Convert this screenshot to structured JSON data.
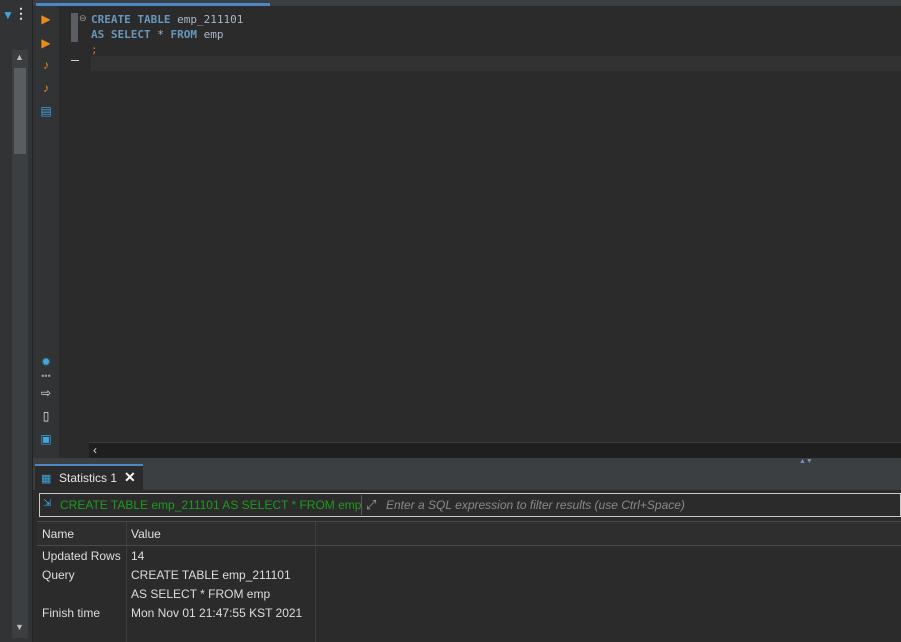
{
  "editor": {
    "line1": {
      "kw": "CREATE TABLE",
      "rest": " emp_211101"
    },
    "line2": {
      "kw1": "AS SELECT",
      "star": " * ",
      "kw2": "FROM",
      "rest": " emp"
    },
    "line3": ";"
  },
  "results": {
    "tab_label": "Statistics 1",
    "filter": {
      "query_text": "CREATE TABLE emp_211101 AS SELECT * FROM emp",
      "placeholder": "Enter a SQL expression to filter results (use Ctrl+Space)"
    },
    "columns": [
      "Name",
      "Value"
    ],
    "rows": [
      {
        "name": "Updated Rows",
        "value": "14"
      },
      {
        "name": "Query",
        "value": "CREATE TABLE emp_211101",
        "value2": "AS SELECT * FROM emp"
      },
      {
        "name": "Finish time",
        "value": "Mon Nov 01 21:47:55 KST 2021"
      }
    ]
  },
  "colors": {
    "accent": "#4a88c7",
    "keyword": "#6897bb",
    "filter_text": "#1f9a1f",
    "tool_orange": "#e98b1b",
    "tool_blue": "#3ea7e0"
  },
  "icons": {
    "tools": [
      "execute-statement-icon",
      "execute-in-new-tab-icon",
      "execute-script-icon",
      "execute-script-new-tab-icon",
      "explain-plan-icon",
      "settings-icon",
      "export-icon",
      "close-result-icon",
      "results-panel-icon"
    ]
  }
}
